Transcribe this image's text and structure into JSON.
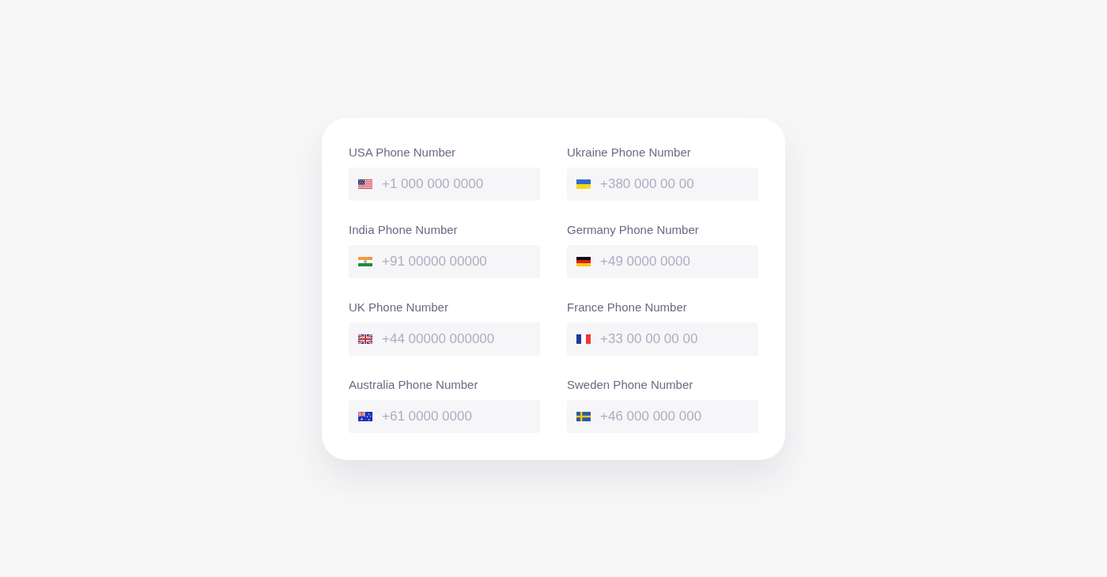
{
  "fields": [
    {
      "kind": "us",
      "label": "USA Phone Number",
      "placeholder": "+1 000 000 0000"
    },
    {
      "kind": "ua",
      "label": "Ukraine Phone Number",
      "placeholder": "+380 000 00 00"
    },
    {
      "kind": "in",
      "label": "India Phone Number",
      "placeholder": "+91 00000 00000"
    },
    {
      "kind": "de",
      "label": "Germany Phone Number",
      "placeholder": "+49 0000 0000"
    },
    {
      "kind": "gb",
      "label": "UK Phone Number",
      "placeholder": "+44 00000 000000"
    },
    {
      "kind": "fr",
      "label": "France Phone Number",
      "placeholder": "+33 00 00 00 00"
    },
    {
      "kind": "au",
      "label": "Australia Phone Number",
      "placeholder": "+61 0000 0000"
    },
    {
      "kind": "se",
      "label": "Sweden Phone Number",
      "placeholder": "+46 000 000 000"
    }
  ]
}
